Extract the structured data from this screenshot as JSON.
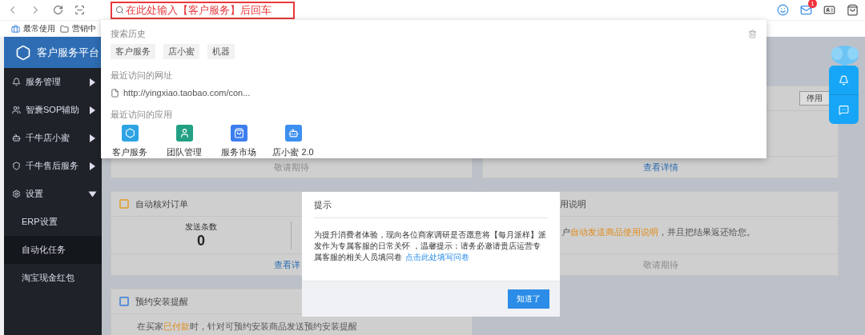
{
  "browser": {
    "address_value": "在此处输入【客户服务】后回车",
    "mail_badge": "1"
  },
  "bookmarks": [
    "最常使用",
    "营销中"
  ],
  "sidebar": {
    "title": "客户服务平台",
    "items": [
      {
        "kind": "bell",
        "label": "服务管理",
        "expanded": false
      },
      {
        "kind": "team",
        "label": "智囊SOP辅助",
        "expanded": false
      },
      {
        "kind": "bot",
        "label": "千牛店小蜜",
        "expanded": false
      },
      {
        "kind": "shield",
        "label": "千牛售后服务",
        "expanded": false
      },
      {
        "kind": "gear",
        "label": "设置",
        "expanded": true,
        "children": [
          {
            "label": "ERP设置",
            "selected": false
          },
          {
            "label": "自动化任务",
            "selected": true
          },
          {
            "label": "淘宝现金红包",
            "selected": false
          }
        ]
      }
    ]
  },
  "top_cards": {
    "left_footer": "敬请期待",
    "right_button": "停用",
    "right_footer": "查看详情"
  },
  "order_check": {
    "title": "自动核对订单",
    "stat_label": "发送条数",
    "stat_value": "0",
    "footer": "查看详"
  },
  "instructions_card": {
    "title": "用说明",
    "text": [
      {
        "text": "户",
        "highlight": false
      },
      {
        "text": "自动发送商品使用说明",
        "highlight": true
      },
      {
        "text": "，并且把结果返还给您。",
        "highlight": false
      }
    ],
    "footer": "敬请期待"
  },
  "install_card": {
    "title": "预约安装提醒",
    "text": [
      {
        "text": "在买家",
        "highlight": false
      },
      {
        "text": "已付款",
        "highlight": true
      },
      {
        "text": "时，针对可预约安装商品发送预约安装提醒",
        "highlight": false
      }
    ]
  },
  "dropdown": {
    "history_label": "搜索历史",
    "history": [
      "客户服务",
      "店小蜜",
      "机器"
    ],
    "urls_label": "最近访问的网址",
    "urls": [
      "http://yingxiao.taobao.com/con..."
    ],
    "apps_label": "最近访问的应用",
    "apps": [
      {
        "kind": "service",
        "label": "客户服务",
        "color": "#2ea3e3"
      },
      {
        "kind": "team",
        "label": "团队管理",
        "color": "#23a083"
      },
      {
        "kind": "market",
        "label": "服务市场",
        "color": "#3d7ef0"
      },
      {
        "kind": "bot",
        "label": "店小蜜 2.0",
        "color": "#3d8ff0"
      }
    ]
  },
  "modal": {
    "title": "提示",
    "body": "为提升消费者体验，现向各位商家调研是否愿意将【每月派样】派发作为专属客服的日常关怀 ，温馨提示：请务必邀请贵店运营专属客服的相关人员填问卷",
    "link": "点击此处填写问卷",
    "button": "知道了"
  }
}
